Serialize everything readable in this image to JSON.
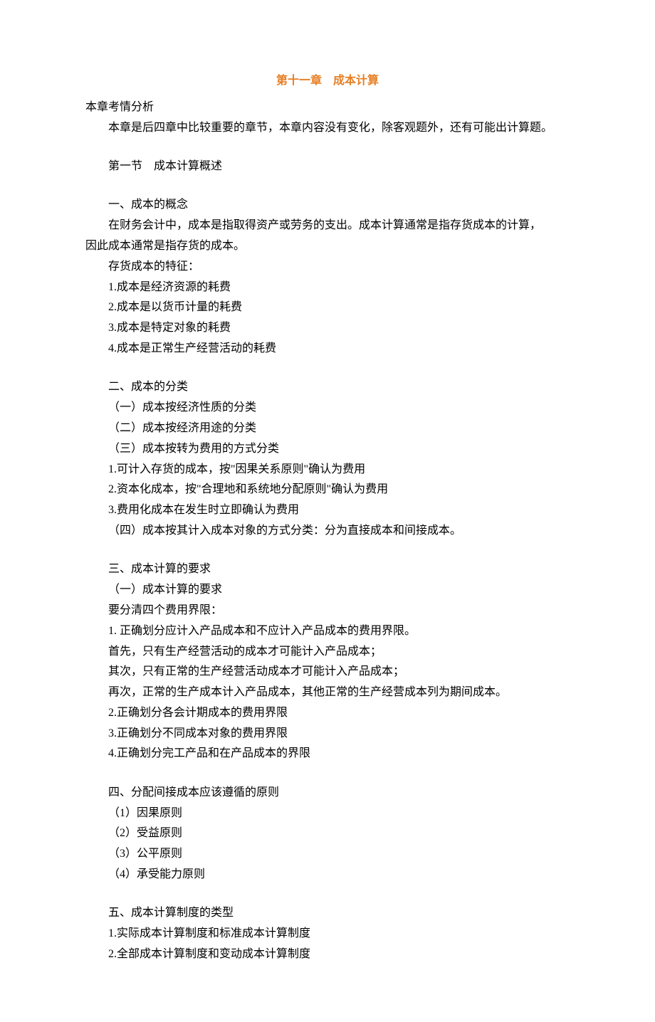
{
  "title": "第十一章　成本计算",
  "intro_heading": "本章考情分析",
  "intro_body": "本章是后四章中比较重要的章节，本章内容没有变化，除客观题外，还有可能出计算题。",
  "section1": {
    "heading": "第一节　成本计算概述",
    "sub1": {
      "heading": "一、成本的概念",
      "body1": "在财务会计中，成本是指取得资产或劳务的支出。成本计算通常是指存货成本的计算，",
      "body2": "因此成本通常是指存货的成本。",
      "feature_heading": "存货成本的特征：",
      "features": [
        "1.成本是经济资源的耗费",
        "2.成本是以货币计量的耗费",
        "3.成本是特定对象的耗费",
        "4.成本是正常生产经营活动的耗费"
      ]
    },
    "sub2": {
      "heading": "二、成本的分类",
      "items": [
        "（一）成本按经济性质的分类",
        "（二）成本按经济用途的分类",
        "（三）成本按转为费用的方式分类",
        "1.可计入存货的成本，按\"因果关系原则\"确认为费用",
        "2.资本化成本，按\"合理地和系统地分配原则\"确认为费用",
        "3.费用化成本在发生时立即确认为费用",
        "（四）成本按其计入成本对象的方式分类：分为直接成本和间接成本。"
      ]
    },
    "sub3": {
      "heading": "三、成本计算的要求",
      "subheading": "（一）成本计算的要求",
      "lead": "要分清四个费用界限：",
      "items": [
        "1. 正确划分应计入产品成本和不应计入产品成本的费用界限。",
        "首先，只有生产经营活动的成本才可能计入产品成本；",
        "其次，只有正常的生产经营活动成本才可能计入产品成本；",
        "再次，正常的生产成本计入产品成本，其他正常的生产经营成本列为期间成本。",
        "2.正确划分各会计期成本的费用界限",
        "3.正确划分不同成本对象的费用界限",
        "4.正确划分完工产品和在产品成本的界限"
      ]
    },
    "sub4": {
      "heading": "四、分配间接成本应该遵循的原则",
      "items": [
        "（1）因果原则",
        "（2）受益原则",
        "（3）公平原则",
        "（4）承受能力原则"
      ]
    },
    "sub5": {
      "heading": "五、成本计算制度的类型",
      "items": [
        "1.实际成本计算制度和标准成本计算制度",
        "2.全部成本计算制度和变动成本计算制度"
      ]
    }
  }
}
